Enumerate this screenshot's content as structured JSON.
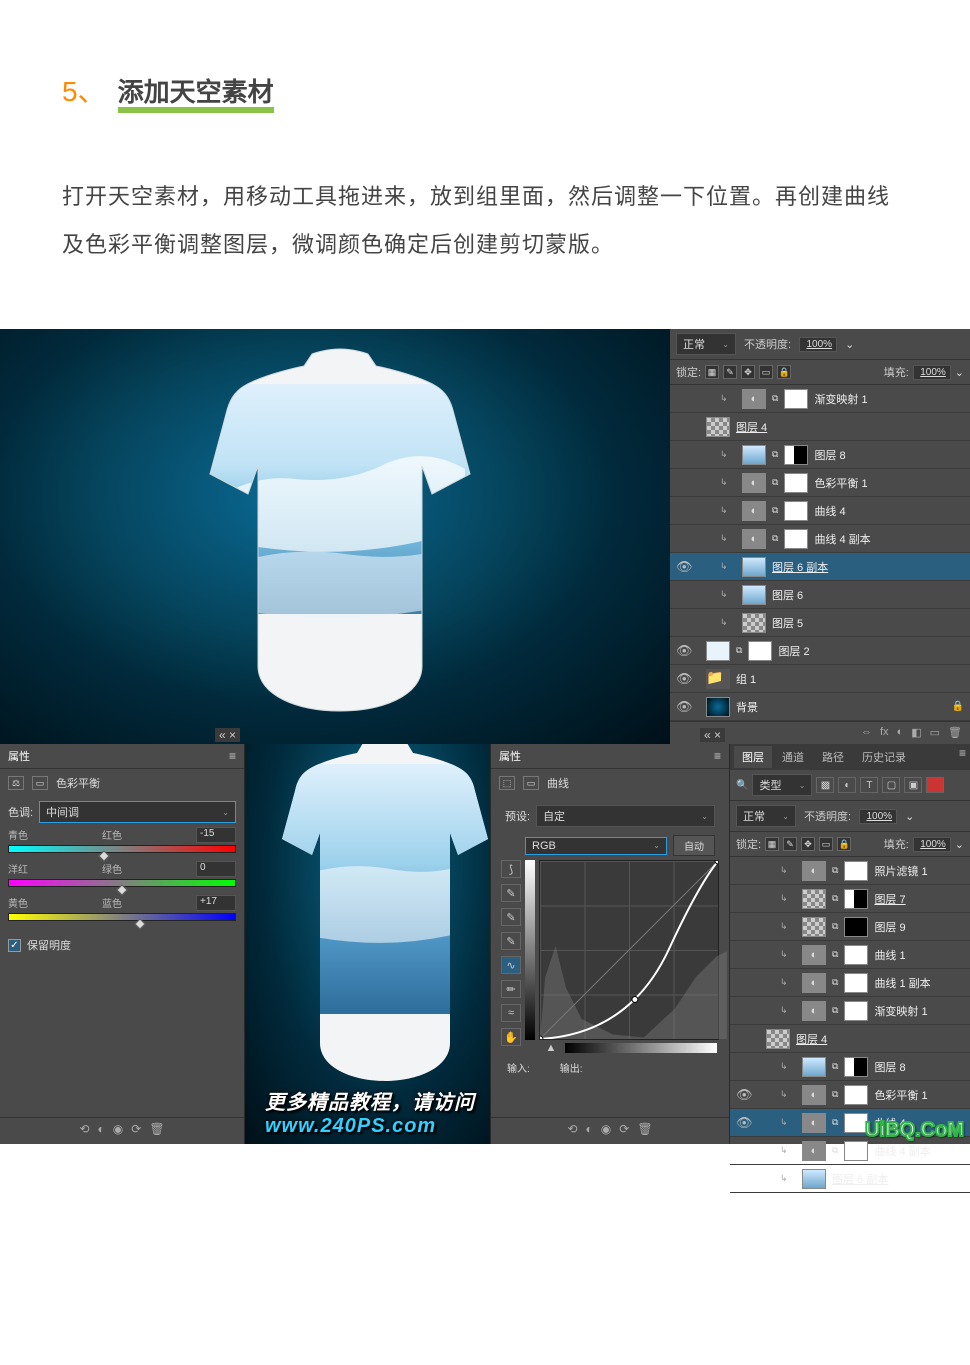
{
  "heading": {
    "number": "5、",
    "title": "添加天空素材"
  },
  "body": "打开天空素材，用移动工具拖进来，放到组里面，然后调整一下位置。再创建曲线及色彩平衡调整图层，微调颜色确定后创建剪切蒙版。",
  "layers_top": {
    "blend_label": "正常",
    "opacity_label": "不透明度:",
    "opacity_value": "100%",
    "lock_label": "锁定:",
    "fill_label": "填充:",
    "fill_value": "100%",
    "rows": [
      {
        "vis": "",
        "clip": true,
        "thumbs": [
          "adj",
          "white"
        ],
        "name": "渐变映射 1"
      },
      {
        "vis": "",
        "clip": false,
        "thumbs": [
          "checker"
        ],
        "name": "图层 4",
        "ul": true
      },
      {
        "vis": "",
        "clip": true,
        "thumbs": [
          "sky",
          "bwmask"
        ],
        "name": "图层 8"
      },
      {
        "vis": "",
        "clip": true,
        "thumbs": [
          "adj",
          "white"
        ],
        "name": "色彩平衡 1"
      },
      {
        "vis": "",
        "clip": true,
        "thumbs": [
          "adj",
          "white"
        ],
        "name": "曲线 4"
      },
      {
        "vis": "",
        "clip": true,
        "thumbs": [
          "adj",
          "white"
        ],
        "name": "曲线 4 副本"
      },
      {
        "vis": "👁",
        "clip": true,
        "thumbs": [
          "sky"
        ],
        "name": "图层 6 副本",
        "ul": true,
        "sel": true
      },
      {
        "vis": "",
        "clip": true,
        "thumbs": [
          "sky"
        ],
        "name": "图层 6"
      },
      {
        "vis": "",
        "clip": true,
        "thumbs": [
          "checker"
        ],
        "name": "图层 5"
      },
      {
        "vis": "👁",
        "clip": false,
        "thumbs": [
          "shirt",
          "white"
        ],
        "name": "图层 2"
      },
      {
        "vis": "👁",
        "clip": false,
        "thumbs": [
          "folder"
        ],
        "name": "组 1"
      },
      {
        "vis": "👁",
        "clip": false,
        "thumbs": [
          "bg"
        ],
        "name": "背景",
        "lock": true
      }
    ],
    "footer_icons": [
      "⟲",
      "fx",
      "◐",
      "◧",
      "▭",
      "🗑"
    ]
  },
  "cb_panel": {
    "tab": "属性",
    "icon_label": "色彩平衡",
    "tone_label": "色调:",
    "tone_value": "中间调",
    "sliders": [
      {
        "left": "青色",
        "right": "红色",
        "val": "-15",
        "pos": 42
      },
      {
        "left": "洋红",
        "right": "绿色",
        "val": "0",
        "pos": 50
      },
      {
        "left": "黄色",
        "right": "蓝色",
        "val": "+17",
        "pos": 58
      }
    ],
    "preserve": "保留明度",
    "footer": [
      "⟲",
      "◐",
      "◉",
      "⟳",
      "🗑"
    ]
  },
  "curves_panel": {
    "tab": "属性",
    "icon_label": "曲线",
    "preset_label": "预设:",
    "preset_value": "自定",
    "channel_value": "RGB",
    "auto": "自动",
    "input": "输入:",
    "output": "输出:",
    "footer": [
      "⟲",
      "◐",
      "◉",
      "⟳",
      "🗑"
    ]
  },
  "layers_bottom": {
    "tabs": [
      "图层",
      "通道",
      "路径",
      "历史记录"
    ],
    "kind_label": "类型",
    "blend_label": "正常",
    "opacity_label": "不透明度:",
    "opacity_value": "100%",
    "lock_label": "锁定:",
    "fill_label": "填充:",
    "fill_value": "100%",
    "rows": [
      {
        "vis": "",
        "clip": true,
        "thumbs": [
          "adj",
          "white"
        ],
        "name": "照片滤镜 1"
      },
      {
        "vis": "",
        "clip": true,
        "thumbs": [
          "checker",
          "bwmask"
        ],
        "name": "图层 7",
        "ul": true
      },
      {
        "vis": "",
        "clip": true,
        "thumbs": [
          "checker",
          "black"
        ],
        "name": "图层 9"
      },
      {
        "vis": "",
        "clip": true,
        "thumbs": [
          "adj",
          "white"
        ],
        "name": "曲线 1"
      },
      {
        "vis": "",
        "clip": true,
        "thumbs": [
          "adj",
          "white"
        ],
        "name": "曲线 1 副本"
      },
      {
        "vis": "",
        "clip": true,
        "thumbs": [
          "adj",
          "white"
        ],
        "name": "渐变映射 1"
      },
      {
        "vis": "",
        "clip": false,
        "thumbs": [
          "checker"
        ],
        "name": "图层 4",
        "ul": true
      },
      {
        "vis": "",
        "clip": true,
        "thumbs": [
          "sky",
          "bwmask"
        ],
        "name": "图层 8"
      },
      {
        "vis": "👁",
        "clip": true,
        "thumbs": [
          "adj",
          "white"
        ],
        "name": "色彩平衡 1"
      },
      {
        "vis": "👁",
        "clip": true,
        "thumbs": [
          "adj",
          "white"
        ],
        "name": "曲线 4",
        "sel": true
      },
      {
        "vis": "",
        "clip": true,
        "thumbs": [
          "adj",
          "white"
        ],
        "name": "曲线 4 副本"
      },
      {
        "vis": "",
        "clip": true,
        "thumbs": [
          "sky"
        ],
        "name": "图层 6 副本",
        "ul": true
      }
    ]
  },
  "watermark": {
    "text": "更多精品教程，请访问 ",
    "url": "www.240PS.com"
  },
  "brand": "UiBQ.CoM"
}
